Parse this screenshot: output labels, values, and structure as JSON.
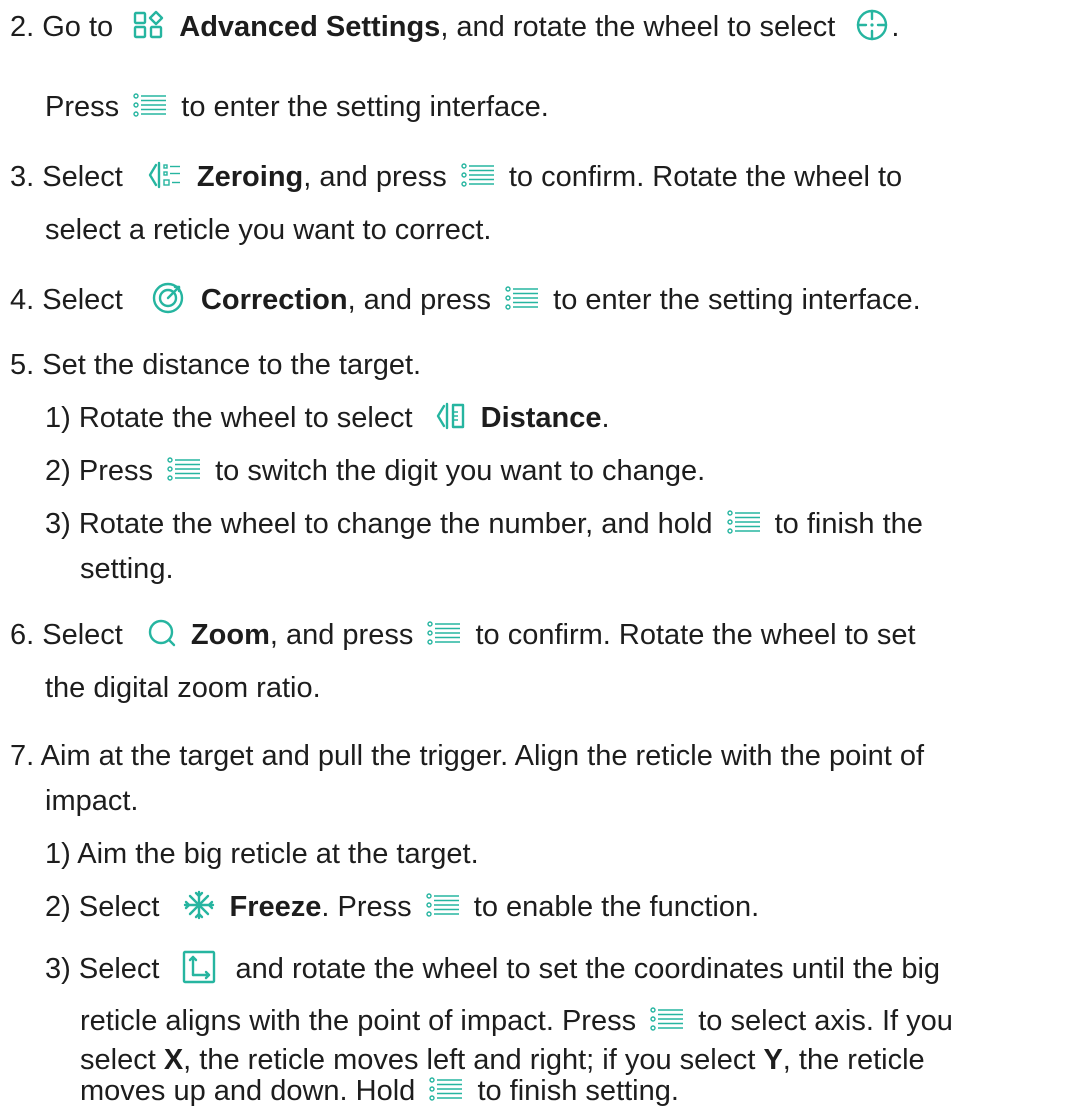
{
  "step2": {
    "num": "2.",
    "t1": "Go to",
    "menu": "Advanced Settings",
    "t2": ", and rotate the wheel to select",
    "t3": ".",
    "l2a": "Press",
    "l2b": "to enter the setting interface."
  },
  "step3": {
    "num": "3.",
    "t1": "Select",
    "menu": "Zeroing",
    "t2": ", and press",
    "t3": "to confirm. Rotate the wheel to",
    "l2": "select a reticle you want to correct."
  },
  "step4": {
    "num": "4.",
    "t1": "Select",
    "menu": "Correction",
    "t2": ", and press",
    "t3": "to enter the setting interface."
  },
  "step5": {
    "num": "5.",
    "text": "Set the distance to the target.",
    "sub1": {
      "num": "1)",
      "t1": "Rotate the wheel to select",
      "menu": "Distance",
      "t2": "."
    },
    "sub2": {
      "num": "2)",
      "t1": "Press",
      "t2": "to switch the digit you want to change."
    },
    "sub3": {
      "num": "3)",
      "t1": "Rotate the wheel to change the number, and hold",
      "t2": "to finish the",
      "l2": "setting."
    }
  },
  "step6": {
    "num": "6.",
    "t1": "Select",
    "menu": "Zoom",
    "t2": ", and press",
    "t3": "to confirm. Rotate the wheel to set",
    "l2": "the digital zoom ratio."
  },
  "step7": {
    "num": "7.",
    "l1": "Aim at the target and pull the trigger. Align the reticle with the point of",
    "l2": "impact.",
    "sub1": {
      "num": "1)",
      "text": "Aim the big reticle at the target."
    },
    "sub2": {
      "num": "2)",
      "t1": "Select",
      "menu": "Freeze",
      "t2": ". Press",
      "t3": "to enable the function."
    },
    "sub3": {
      "num": "3)",
      "t1": "Select",
      "t2": "and rotate the wheel to set the coordinates until the big",
      "l2a": "reticle aligns with the point of impact. Press",
      "l2b": "to select axis. If you",
      "l3a": "select",
      "x": "X",
      "l3b": ", the reticle moves left and right; if you select",
      "y": "Y",
      "l3c": ", the reticle",
      "l4a": "moves up and down. Hold",
      "l4b": "to finish setting."
    }
  },
  "icons": {
    "accent": "#26b5a0",
    "menu_key": "menu-key-icon",
    "advanced_settings": "advanced-settings-icon",
    "reticle": "reticle-icon",
    "zeroing": "zeroing-icon",
    "correction": "correction-icon",
    "distance": "distance-icon",
    "zoom": "zoom-icon",
    "freeze": "freeze-icon",
    "coordinates": "coordinates-icon"
  }
}
